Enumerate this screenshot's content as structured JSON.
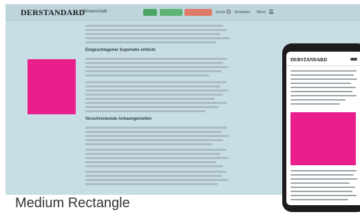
{
  "desktop": {
    "logo": "DERSTANDARD",
    "section": "› Wissenschaft",
    "nav": {
      "pill_1": "",
      "pill_2": "",
      "pill_3": "",
      "link_1": "Suche",
      "link_2": "Anmelden",
      "link_3": "Menü"
    },
    "subheads": [
      "Eingeschlagener Superlativ erblickt",
      "Vorschreckende Anhaengerzeiten"
    ]
  },
  "phone": {
    "logo": "DERSTANDARD"
  },
  "caption": "Medium Rectangle",
  "colors": {
    "ad": "#e81f8c",
    "page_bg": "#c9dde4",
    "phone_frame": "#1c1c1c"
  }
}
